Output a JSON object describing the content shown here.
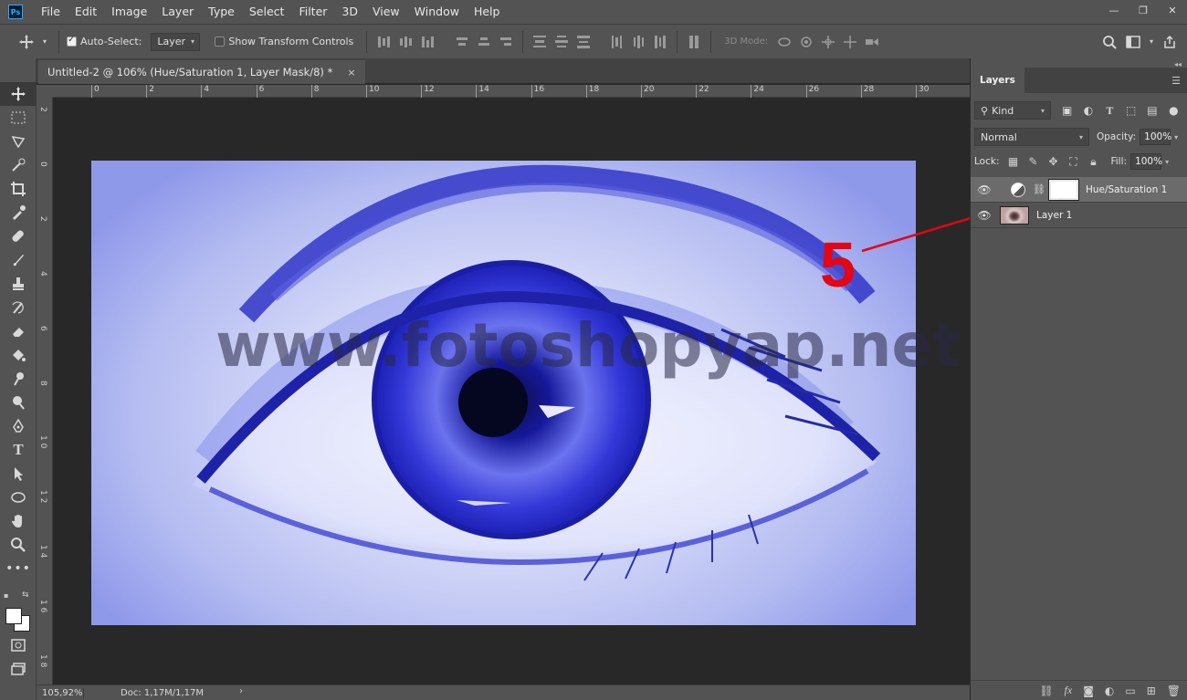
{
  "app": {
    "logo_text": "Ps"
  },
  "menu": {
    "items": [
      "File",
      "Edit",
      "Image",
      "Layer",
      "Type",
      "Select",
      "Filter",
      "3D",
      "View",
      "Window",
      "Help"
    ]
  },
  "window_controls": {
    "minimize": "—",
    "restore": "❐",
    "close": "✕"
  },
  "options_bar": {
    "auto_select_label": "Auto-Select:",
    "auto_select_checked": true,
    "auto_select_target": "Layer",
    "show_transform_label": "Show Transform Controls",
    "show_transform_checked": false,
    "mode_3d_label": "3D Mode:"
  },
  "document": {
    "tab_title": "Untitled-2 @ 106% (Hue/Saturation 1, Layer Mask/8) *",
    "tab_close": "×",
    "ruler_top_labels": [
      "0",
      "2",
      "4",
      "6",
      "8",
      "10",
      "12",
      "14",
      "16",
      "18",
      "20",
      "22",
      "24",
      "26",
      "28",
      "30"
    ],
    "ruler_left_labels": [
      "2",
      "0",
      "2",
      "4",
      "6",
      "8",
      "1 0",
      "1 2",
      "1 4",
      "1 6",
      "1 8"
    ],
    "watermark": "www.fotoshopyap.net",
    "annotation_number": "5",
    "annotation_color": "#e30613"
  },
  "statusbar": {
    "zoom": "105,92%",
    "doc_info": "Doc: 1,17M/1,17M",
    "arrow": "›"
  },
  "layers_panel": {
    "title": "Layers",
    "filter_kind": "Kind",
    "blend_mode": "Normal",
    "opacity_label": "Opacity:",
    "opacity_value": "100%",
    "lock_label": "Lock:",
    "fill_label": "Fill:",
    "fill_value": "100%",
    "layers": [
      {
        "name": "Hue/Saturation 1",
        "type": "adjustment",
        "visible": true,
        "selected": true
      },
      {
        "name": "Layer 1",
        "type": "pixel",
        "visible": true,
        "selected": false
      }
    ]
  },
  "colors": {
    "ui_panel": "#535353",
    "ui_dark": "#282828",
    "image_tint": "#b4bcf1",
    "iris": "#2b2fd6"
  }
}
